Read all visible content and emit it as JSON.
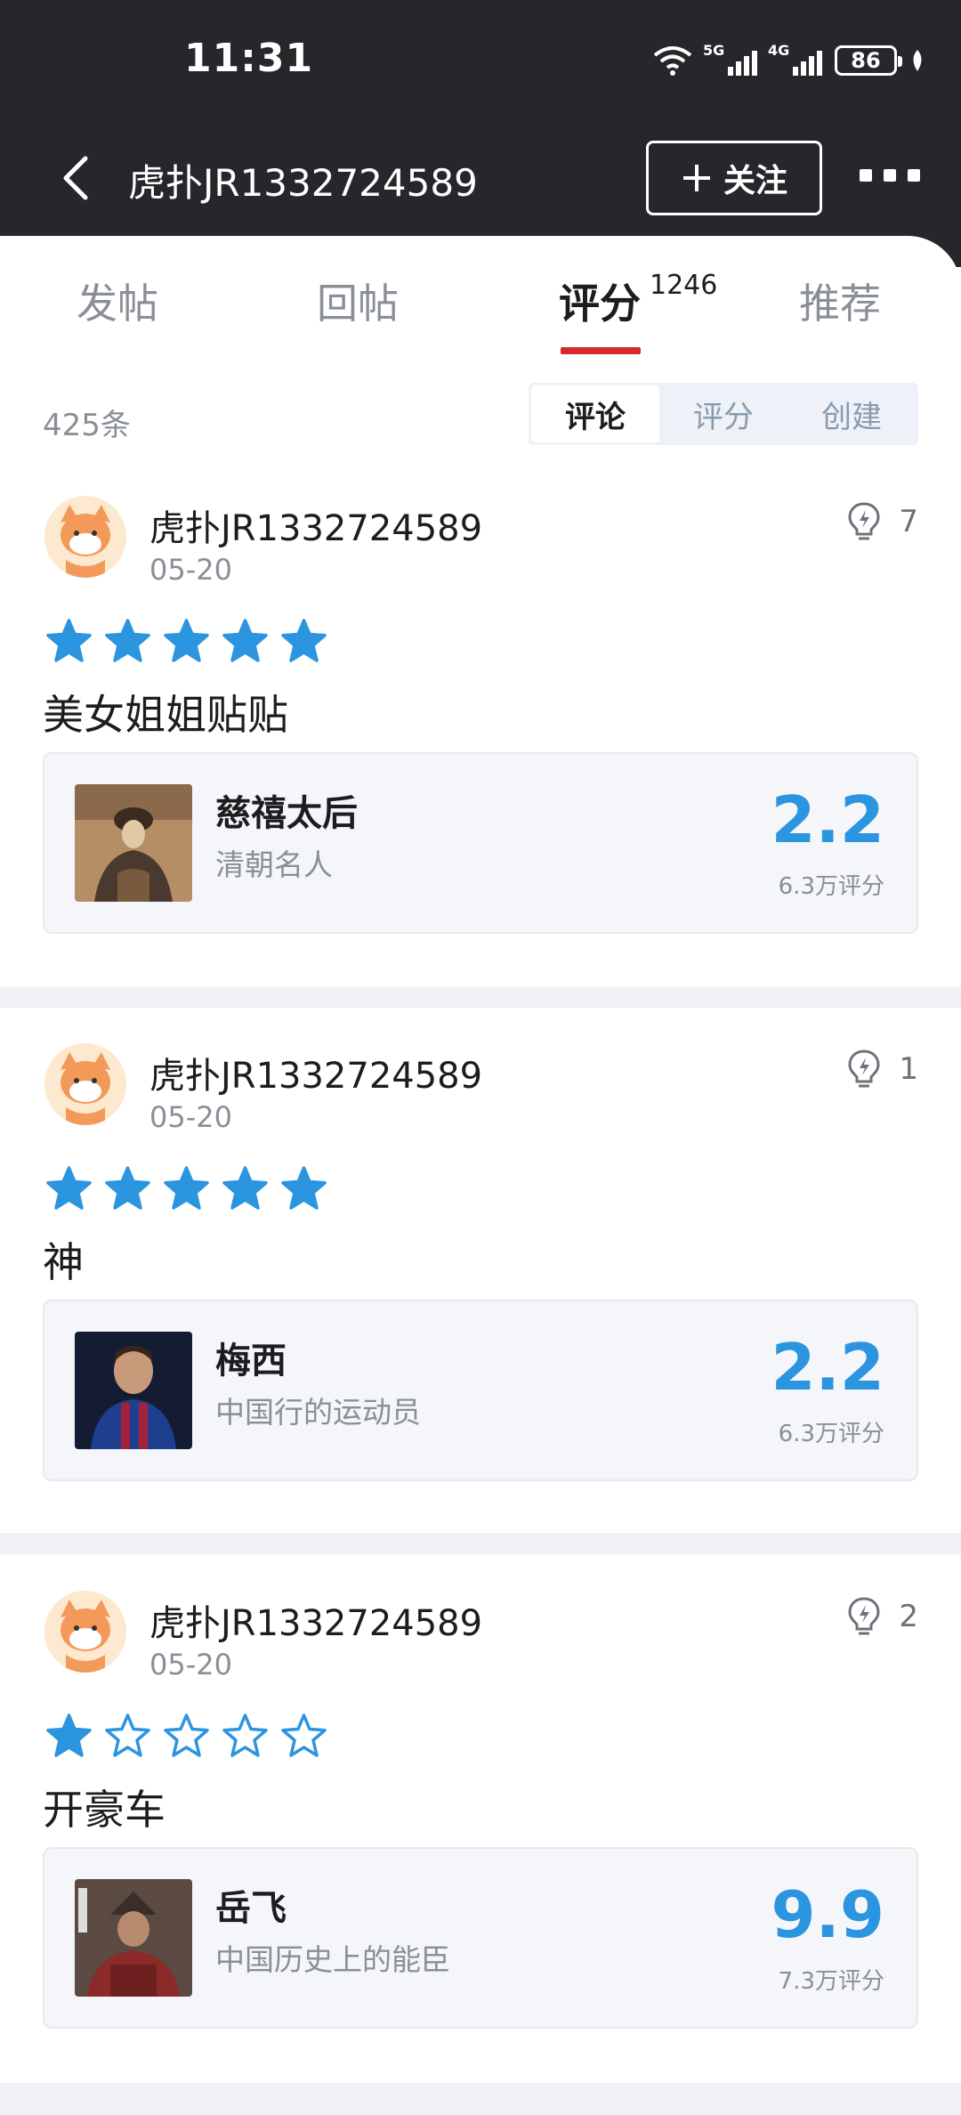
{
  "status_bar": {
    "time": "11:31",
    "net1": "5G",
    "net2": "4G",
    "battery": "86"
  },
  "nav": {
    "title": "虎扑JR1332724589",
    "follow_label": "关注",
    "follow_icon": "plus-icon"
  },
  "tabs": [
    {
      "label": "发帖"
    },
    {
      "label": "回帖"
    },
    {
      "label": "评分",
      "count": "1246"
    },
    {
      "label": "推荐"
    }
  ],
  "list_header": {
    "count": "425条",
    "filters": [
      "评论",
      "评分",
      "创建"
    ],
    "selected_filter": "评论"
  },
  "colors": {
    "accent": "#2b95df",
    "tab_indicator": "#d72a2f",
    "header_bg": "#25272b"
  },
  "reviews": [
    {
      "user": "虎扑JR1332724589",
      "date": "05-20",
      "likes": "7",
      "rating": 5,
      "comment": "美女姐姐贴贴",
      "item": {
        "name": "慈禧太后",
        "desc": "清朝名人",
        "score": "2.2",
        "score_count": "6.3万评分"
      }
    },
    {
      "user": "虎扑JR1332724589",
      "date": "05-20",
      "likes": "1",
      "rating": 5,
      "comment": "神",
      "item": {
        "name": "梅西",
        "desc": "中国行的运动员",
        "score": "2.2",
        "score_count": "6.3万评分"
      }
    },
    {
      "user": "虎扑JR1332724589",
      "date": "05-20",
      "likes": "2",
      "rating": 1,
      "comment": "开豪车",
      "item": {
        "name": "岳飞",
        "desc": "中国历史上的能臣",
        "score": "9.9",
        "score_count": "7.3万评分"
      }
    }
  ]
}
